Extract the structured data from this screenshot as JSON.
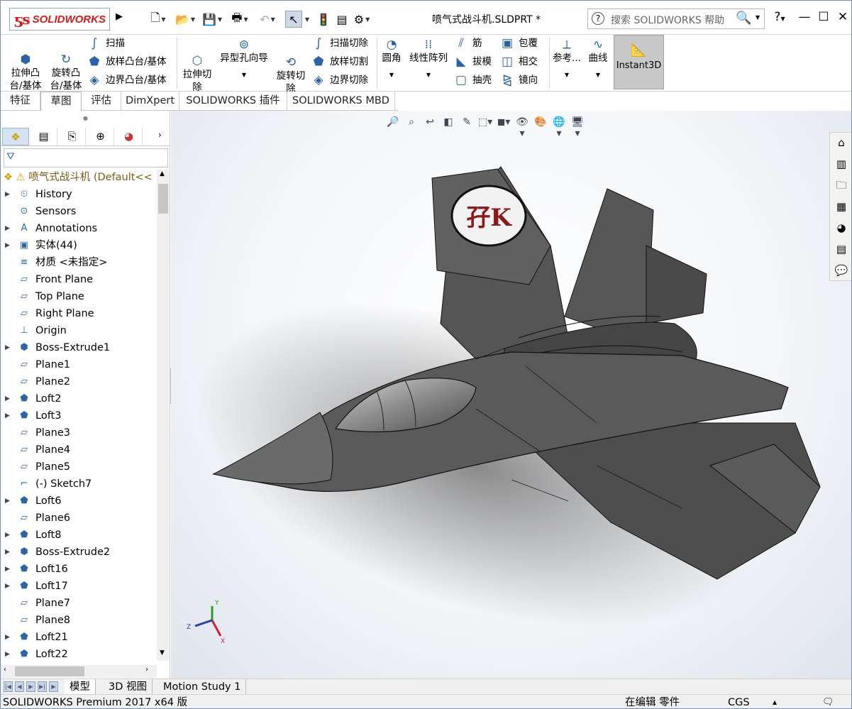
{
  "titlebar": {
    "logo_prefix": "ƽs",
    "logo_text": "SOLIDWORKS",
    "doc_title": "喷气式战斗机.SLDPRT *",
    "search_placeholder": "搜索 SOLIDWORKS 帮助",
    "help_label": "?"
  },
  "toolbar": {
    "extrude_boss": "拉伸凸\n台/基体",
    "revolve_boss": "旋转凸\n台/基体",
    "sweep": "扫描",
    "loft_boss": "放样凸台/基体",
    "boundary_boss": "边界凸台/基体",
    "extrude_cut": "拉伸切\n除",
    "hole_wizard": "异型孔向导",
    "revolve_cut": "旋转切\n除",
    "sweep_cut": "扫描切除",
    "loft_cut": "放样切割",
    "boundary_cut": "边界切除",
    "fillet": "圆角",
    "linear_pattern": "线性阵列",
    "rib": "筋",
    "draft": "拔模",
    "shell": "抽壳",
    "wrap": "包覆",
    "intersect": "相交",
    "mirror": "镜向",
    "reference": "参考...",
    "curves": "曲线",
    "instant3d": "Instant3D"
  },
  "tabs": [
    "特征",
    "草图",
    "评估",
    "DimXpert",
    "SOLIDWORKS 插件",
    "SOLIDWORKS MBD"
  ],
  "tree": {
    "root": "喷气式战斗机  (Default<<",
    "items": [
      {
        "label": "History",
        "icon": "history-icon",
        "expand": true
      },
      {
        "label": "Sensors",
        "icon": "sensors-icon",
        "expand": false
      },
      {
        "label": "Annotations",
        "icon": "annotations-icon",
        "expand": true
      },
      {
        "label": "实体(44)",
        "icon": "solid-bodies-icon",
        "expand": true
      },
      {
        "label": "材质 <未指定>",
        "icon": "material-icon",
        "expand": false
      },
      {
        "label": "Front Plane",
        "icon": "plane-icon",
        "expand": false
      },
      {
        "label": "Top Plane",
        "icon": "plane-icon",
        "expand": false
      },
      {
        "label": "Right Plane",
        "icon": "plane-icon",
        "expand": false
      },
      {
        "label": "Origin",
        "icon": "origin-icon",
        "expand": false
      },
      {
        "label": "Boss-Extrude1",
        "icon": "boss-extrude-icon",
        "expand": true
      },
      {
        "label": "Plane1",
        "icon": "plane-icon",
        "expand": false
      },
      {
        "label": "Plane2",
        "icon": "plane-icon",
        "expand": false
      },
      {
        "label": "Loft2",
        "icon": "loft-icon",
        "expand": true
      },
      {
        "label": "Loft3",
        "icon": "loft-icon",
        "expand": true
      },
      {
        "label": "Plane3",
        "icon": "plane-icon",
        "expand": false
      },
      {
        "label": "Plane4",
        "icon": "plane-icon",
        "expand": false
      },
      {
        "label": "Plane5",
        "icon": "plane-icon",
        "expand": false
      },
      {
        "label": "(-) Sketch7",
        "icon": "sketch-icon",
        "expand": false
      },
      {
        "label": "Loft6",
        "icon": "loft-icon",
        "expand": true
      },
      {
        "label": "Plane6",
        "icon": "plane-icon",
        "expand": false
      },
      {
        "label": "Loft8",
        "icon": "loft-icon",
        "expand": true
      },
      {
        "label": "Boss-Extrude2",
        "icon": "boss-extrude-icon",
        "expand": true
      },
      {
        "label": "Loft16",
        "icon": "loft-icon",
        "expand": true
      },
      {
        "label": "Loft17",
        "icon": "loft-icon",
        "expand": true
      },
      {
        "label": "Plane7",
        "icon": "plane-icon",
        "expand": false
      },
      {
        "label": "Plane8",
        "icon": "plane-icon",
        "expand": false
      },
      {
        "label": "Loft21",
        "icon": "loft-icon",
        "expand": true
      },
      {
        "label": "Loft22",
        "icon": "loft-icon",
        "expand": true
      }
    ]
  },
  "viewport": {
    "insignia_text": "孖K",
    "triad": {
      "x": "X",
      "y": "Y",
      "z": "Z"
    }
  },
  "bottom_tabs": [
    "模型",
    "3D 视图",
    "Motion Study 1"
  ],
  "status": {
    "left": "SOLIDWORKS Premium 2017 x64 版",
    "editing": "在编辑 零件",
    "units": "CGS"
  },
  "colors": {
    "accent": "#2b66a7",
    "logo_red": "#d61b1b",
    "model_gray": "#5a5a5a",
    "insignia_red": "#8b1a1a"
  }
}
